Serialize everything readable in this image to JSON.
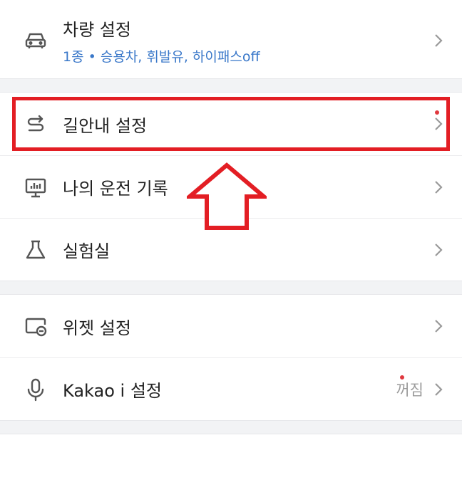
{
  "settings": {
    "vehicle": {
      "label": "차량 설정",
      "sub": "1종 • 승용차, 휘발유, 하이패스off",
      "icon": "car-icon"
    },
    "route": {
      "label": "길안내 설정",
      "icon": "route-icon",
      "new_dot": true
    },
    "driving_record": {
      "label": "나의 운전 기록",
      "icon": "monitor-chart-icon"
    },
    "lab": {
      "label": "실험실",
      "icon": "flask-icon"
    },
    "widget": {
      "label": "위젯 설정",
      "icon": "widget-icon"
    },
    "kakao_i": {
      "label": "Kakao i 설정",
      "value": "꺼짐",
      "icon": "mic-icon",
      "new_dot": true
    },
    "next": {
      "label": "",
      "icon": "partial-icon"
    }
  },
  "colors": {
    "accent_blue": "#3a78c9",
    "highlight_red": "#e31e24",
    "dot_red": "#e0383e"
  }
}
